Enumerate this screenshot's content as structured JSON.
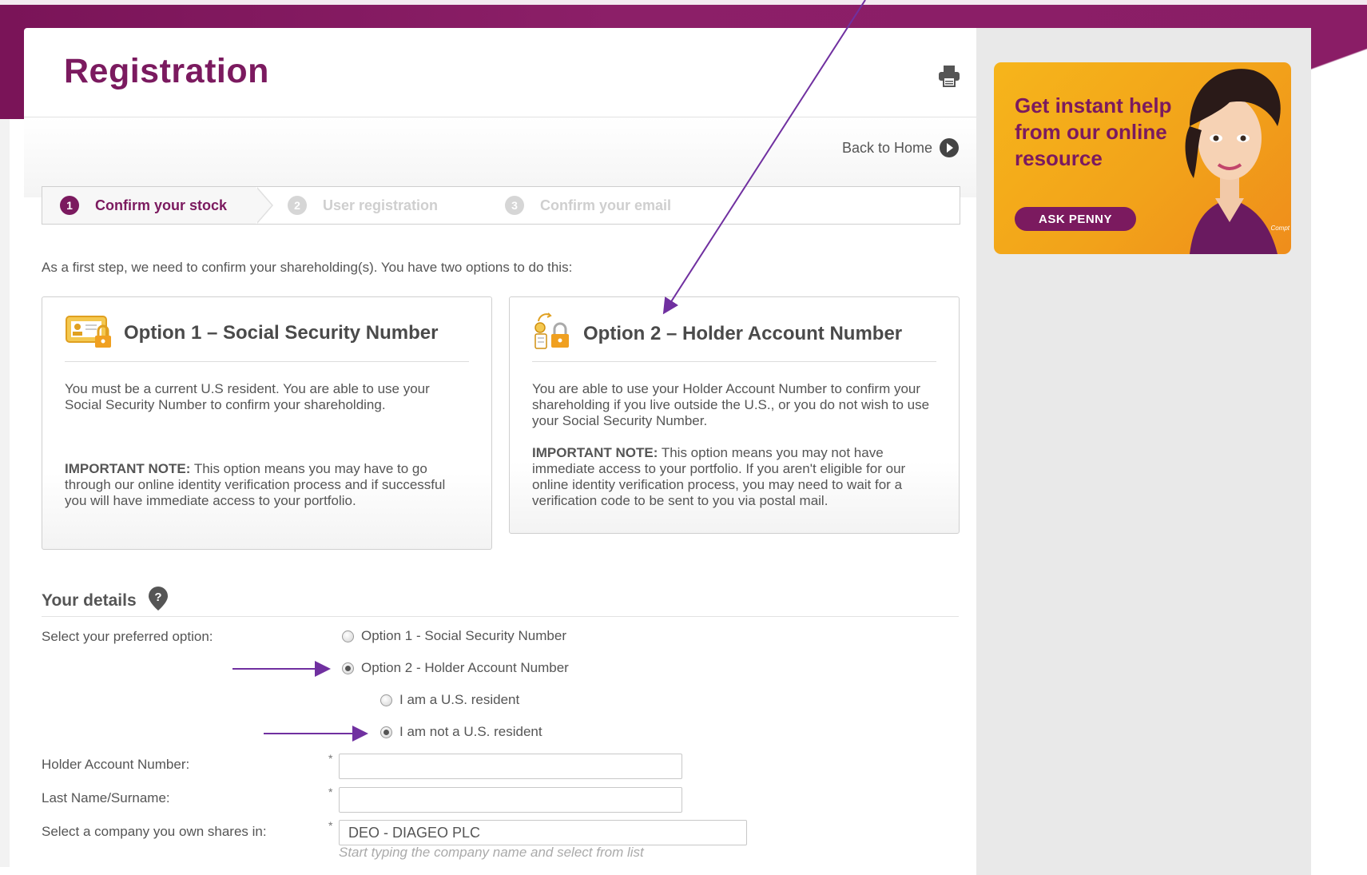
{
  "header": {
    "title": "Registration",
    "print_icon": "printer-icon",
    "back_home": "Back to Home"
  },
  "steps": [
    {
      "number": "1",
      "label": "Confirm your stock",
      "state": "active"
    },
    {
      "number": "2",
      "label": "User registration",
      "state": "inactive"
    },
    {
      "number": "3",
      "label": "Confirm your email",
      "state": "inactive"
    }
  ],
  "intro": "As a first step, we need to confirm your shareholding(s). You have two options to do this:",
  "options": [
    {
      "title": "Option 1 – Social Security Number",
      "icon": "id-card-lock-icon",
      "body": "You must be a current U.S resident. You are able to use your Social Security Number to confirm your shareholding.",
      "note_label": "IMPORTANT NOTE:",
      "note": "This option means you may have to go through our online identity verification process and if successful you will have immediate access to your portfolio."
    },
    {
      "title": "Option 2 – Holder Account Number",
      "icon": "account-lock-icon",
      "body": "You are able to use your Holder Account Number to confirm your shareholding if you live outside the U.S., or you do not wish to use your Social Security Number.",
      "note_label": "IMPORTANT NOTE:",
      "note": "This option means you may not have immediate access to your portfolio. If you aren't eligible for our online identity verification process, you may need to wait for a verification code to be sent to you via postal mail."
    }
  ],
  "details": {
    "title": "Your details",
    "help_icon": "help-pin-icon",
    "preferred_label": "Select your preferred option:",
    "radio_option1": "Option 1 - Social Security Number",
    "radio_option2": "Option 2 - Holder Account Number",
    "radio_resident": "I am a U.S. resident",
    "radio_not_resident": "I am not a U.S. resident",
    "selected_option": "Option 2 - Holder Account Number",
    "selected_residency": "I am not a U.S. resident",
    "holder_label": "Holder Account Number:",
    "holder_value": "",
    "lastname_label": "Last Name/Surname:",
    "lastname_value": "",
    "company_label": "Select a company you own shares in:",
    "company_value": "DEO - DIAGEO PLC",
    "company_hint": "Start typing the company name and select from list",
    "required_marker": "*"
  },
  "promo": {
    "text": "Get instant help from our online resource",
    "button": "ASK PENNY",
    "brand": "Compt"
  },
  "colors": {
    "brand_purple": "#7b1a5f",
    "promo_orange": "#f2a31a",
    "annotation_arrow": "#7030a0"
  }
}
